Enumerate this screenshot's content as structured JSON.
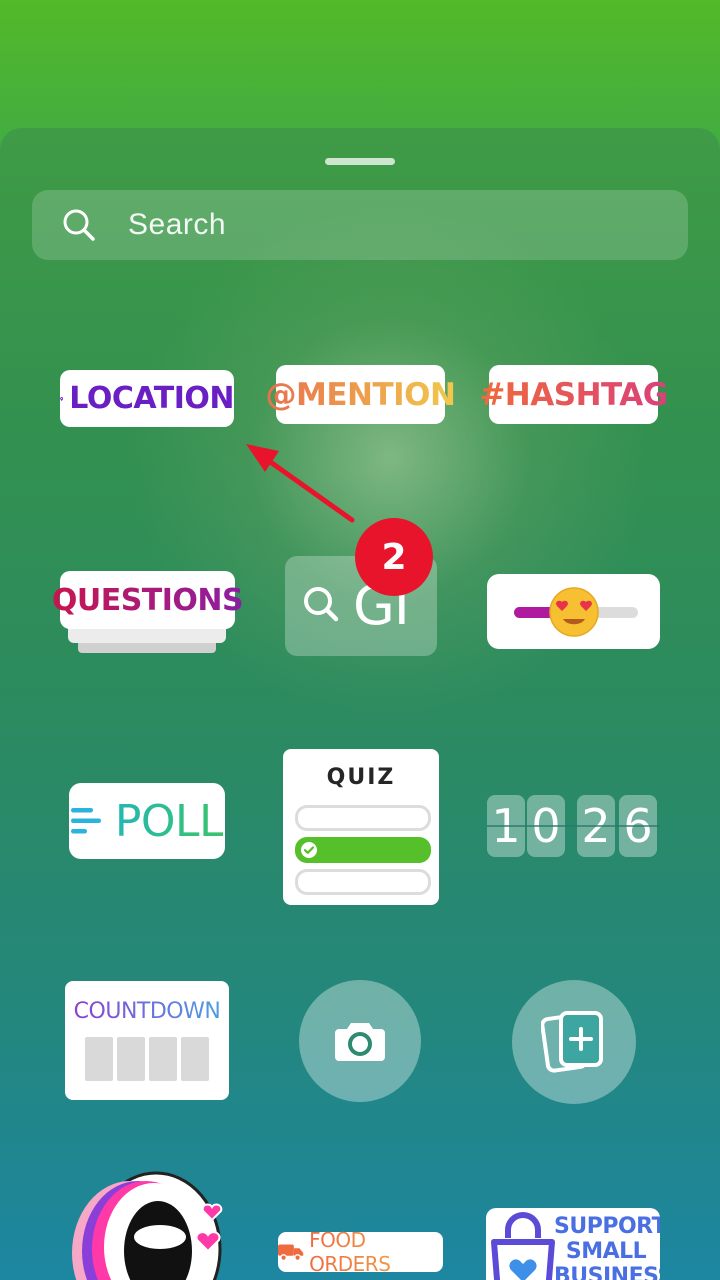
{
  "search": {
    "placeholder": "Search"
  },
  "stickers": {
    "location": "LOCATION",
    "mention": "@MENTION",
    "hashtag": "#HASHTAG",
    "questions": "QUESTIONS",
    "gif": "GI",
    "poll": "POLL",
    "quiz": "QUIZ",
    "time": {
      "h1": "1",
      "h2": "0",
      "m1": "2",
      "m2": "6"
    },
    "countdown": "COUNTDOWN",
    "food_orders": "FOOD ORDERS",
    "support_small_business": [
      "SUPPORT",
      "SMALL",
      "BUSINESS"
    ]
  },
  "annotation": {
    "step_number": "2"
  },
  "colors": {
    "location_purple": "#7a2bd1",
    "mention_gradient": [
      "#e8704d",
      "#f2c94c"
    ],
    "hashtag_gradient": [
      "#f06a3c",
      "#d9407a"
    ],
    "questions_gradient": [
      "#c8164f",
      "#8c1ea3"
    ],
    "poll_gradient": [
      "#2bb3e0",
      "#3ac46b"
    ],
    "countdown_gradient": [
      "#8e3bd1",
      "#4aa3e6"
    ],
    "annotation_red": "#e8142b",
    "quiz_correct": "#55c02a"
  },
  "icons": [
    "search-icon",
    "location-pin-icon",
    "camera-icon",
    "add-media-icon",
    "slider-emoji-icon",
    "food-truck-icon",
    "shopping-bag-icon"
  ]
}
